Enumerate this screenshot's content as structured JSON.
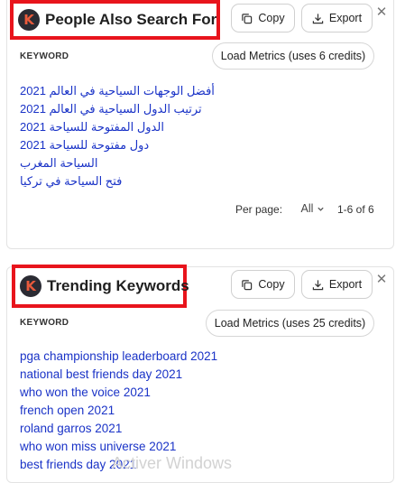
{
  "panels": [
    {
      "title": "People Also Search For",
      "copy_label": "Copy",
      "export_label": "Export",
      "close_glyph": "✕",
      "keyword_header": "KEYWORD",
      "metrics_label": "Load Metrics (uses 6 credits)",
      "keywords": [
        "أفضل الوجهات السياحية في العالم 2021",
        "ترتيب الدول السياحية في العالم 2021",
        "الدول المفتوحة للسياحة 2021",
        "دول مفتوحة للسياحة 2021",
        "السياحة المغرب",
        "فتح السياحة في تركيا"
      ],
      "pager": {
        "per_page_label": "Per page:",
        "per_page_value": "All",
        "range_text": "1-6 of 6"
      }
    },
    {
      "title": "Trending Keywords",
      "copy_label": "Copy",
      "export_label": "Export",
      "close_glyph": "✕",
      "keyword_header": "KEYWORD",
      "metrics_label": "Load Metrics (uses 25 credits)",
      "keywords": [
        "pga championship leaderboard 2021",
        "national best friends day 2021",
        "who won the voice 2021",
        "french open 2021",
        "roland garros 2021",
        "who won miss universe 2021",
        "best friends day 2021"
      ]
    }
  ],
  "logo_letter": "K",
  "watermark": "Activer Windows",
  "colors": {
    "highlight_border": "#e8141c",
    "link": "#1a33c7",
    "logo_bg": "#2b2b33",
    "logo_letter": "#e85a3c"
  },
  "icons": {
    "copy": "copy-icon",
    "export": "download-icon",
    "close": "close-icon",
    "select": "chevron-down-icon"
  }
}
